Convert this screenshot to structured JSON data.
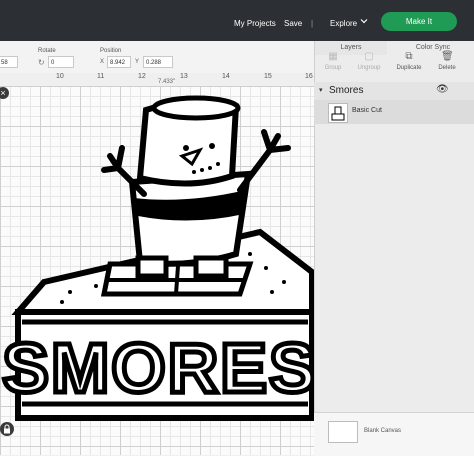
{
  "header": {
    "my_projects": "My Projects",
    "save": "Save",
    "divider": "|",
    "explore": "Explore",
    "make_it": "Make It"
  },
  "toolbar": {
    "size_value": "58",
    "rotate_label": "Rotate",
    "rotate_value": "0",
    "position_label": "Position",
    "x_label": "X",
    "x_value": "8.942",
    "y_label": "Y",
    "y_value": "0.288"
  },
  "ruler": {
    "ticks": [
      "10",
      "11",
      "12",
      "13",
      "14",
      "15",
      "16"
    ],
    "dimension_label": "7.433\""
  },
  "panel": {
    "tabs": [
      "Layers",
      "Color Sync"
    ],
    "tools": [
      "Group",
      "Ungroup",
      "Duplicate",
      "Delete"
    ],
    "group_name": "Smores",
    "layer_name": "Basic Cut",
    "blank_canvas": "Blank Canvas"
  },
  "design": {
    "text": "SMORES",
    "stroke_color": "#000000"
  },
  "colors": {
    "topbar": "#2c2f33",
    "make_it": "#1f9b55",
    "panel": "#ececec"
  }
}
